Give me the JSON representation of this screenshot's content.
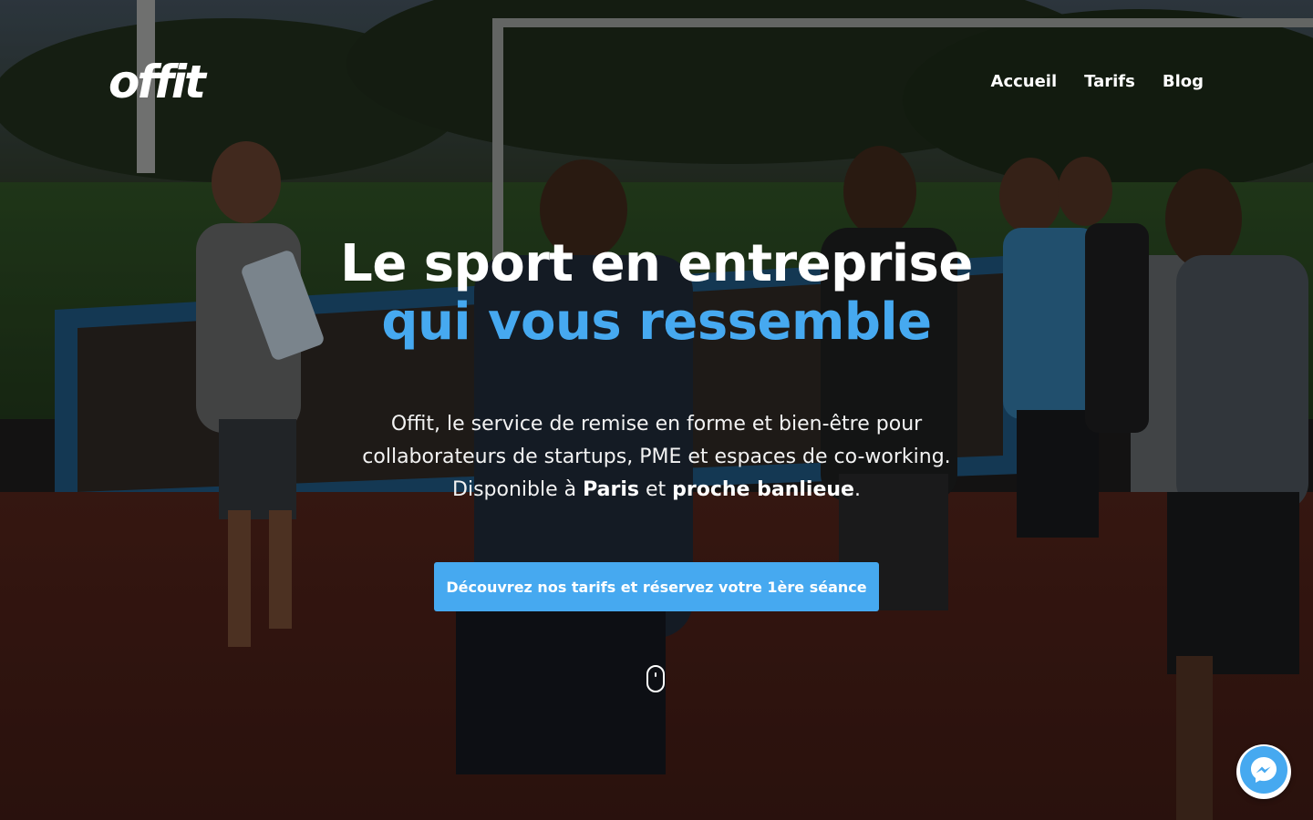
{
  "brand": {
    "logo_text": "offit"
  },
  "nav": {
    "items": [
      {
        "label": "Accueil"
      },
      {
        "label": "Tarifs"
      },
      {
        "label": "Blog"
      }
    ]
  },
  "hero": {
    "headline_line1": "Le sport en entreprise",
    "headline_line2": "qui vous ressemble",
    "subtitle_line1": "Offit, le service de remise en forme et bien-être pour",
    "subtitle_line2": "collaborateurs de startups, PME et espaces de co-working.",
    "subtitle_line3_prefix": "Disponible à ",
    "subtitle_line3_city": "Paris",
    "subtitle_line3_mid": " et ",
    "subtitle_line3_area": "proche banlieue",
    "subtitle_line3_suffix": ".",
    "cta_label": "Découvrez nos tarifs et réservez votre 1ère séance"
  },
  "icons": {
    "scroll": "mouse-scroll-icon",
    "messenger": "messenger-icon"
  },
  "colors": {
    "accent": "#46a9f0",
    "text": "#ffffff"
  }
}
